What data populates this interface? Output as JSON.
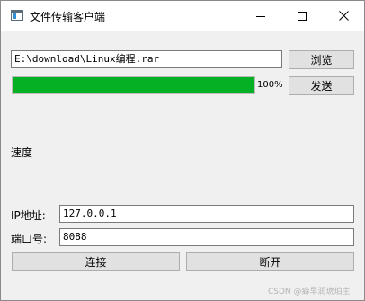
{
  "window": {
    "title": "文件传输客户端"
  },
  "titlebar": {
    "minimize_icon": "minimize-icon",
    "maximize_icon": "maximize-icon",
    "close_icon": "close-icon"
  },
  "file": {
    "path": "E:\\download\\Linux编程.rar",
    "browse_label": "浏览"
  },
  "progress": {
    "value": 100,
    "text": "100%",
    "color": "#06b025"
  },
  "send_label": "发送",
  "speed_label": "速度",
  "ip": {
    "label": "IP地址:",
    "value": "127.0.0.1"
  },
  "port": {
    "label": "端口号:",
    "value": "8088"
  },
  "connect_label": "连接",
  "disconnect_label": "断开",
  "watermark": "CSDN @癖早润琥珀主"
}
